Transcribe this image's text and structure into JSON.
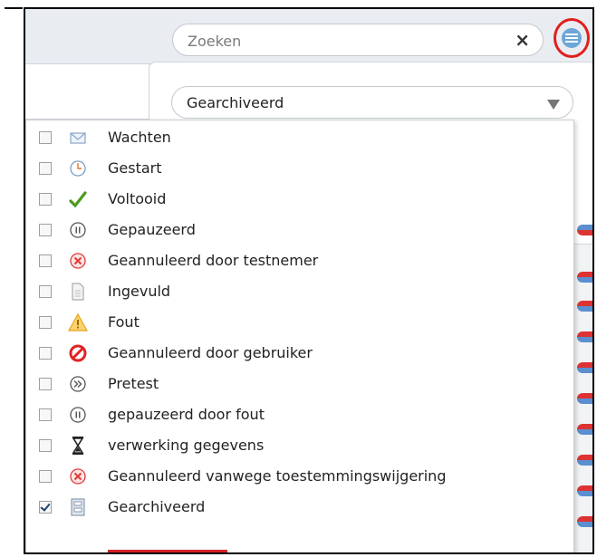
{
  "search": {
    "placeholder": "Zoeken",
    "clear_symbol": "×"
  },
  "filter": {
    "selected": "Gearchiveerd"
  },
  "status_list": [
    {
      "label": "Wachten",
      "icon": "envelope-icon",
      "checked": false
    },
    {
      "label": "Gestart",
      "icon": "clock-icon",
      "checked": false
    },
    {
      "label": "Voltooid",
      "icon": "checkmark-icon",
      "checked": false
    },
    {
      "label": "Gepauzeerd",
      "icon": "pause-icon",
      "checked": false
    },
    {
      "label": "Geannuleerd door testnemer",
      "icon": "cancel-circle-icon",
      "checked": false
    },
    {
      "label": "Ingevuld",
      "icon": "document-icon",
      "checked": false
    },
    {
      "label": "Fout",
      "icon": "warning-icon",
      "checked": false
    },
    {
      "label": "Geannuleerd door gebruiker",
      "icon": "prohibited-icon",
      "checked": false
    },
    {
      "label": "Pretest",
      "icon": "fast-forward-icon",
      "checked": false
    },
    {
      "label": "gepauzeerd door fout",
      "icon": "pause-icon",
      "checked": false
    },
    {
      "label": "verwerking gegevens",
      "icon": "hourglass-icon",
      "checked": false
    },
    {
      "label": "Geannuleerd vanwege toestemmingswijgering",
      "icon": "cancel-circle-icon",
      "checked": false
    },
    {
      "label": "Gearchiveerd",
      "icon": "archive-icon",
      "checked": true
    }
  ],
  "colors": {
    "highlight_red": "#e0201f",
    "menu_blue": "#6ea5d8",
    "check_green": "#4c9a1c"
  }
}
